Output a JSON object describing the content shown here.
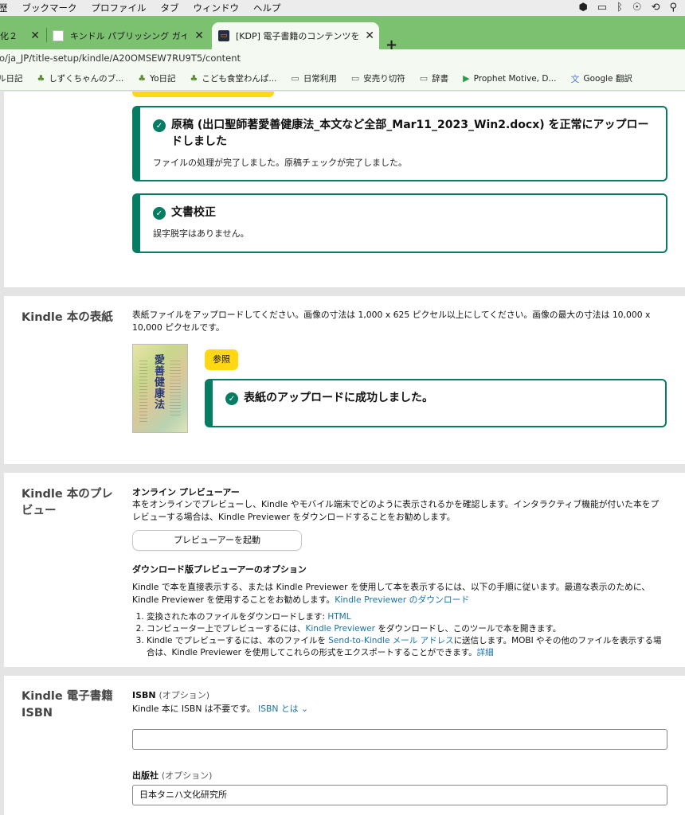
{
  "menubar": {
    "items": [
      "歴",
      "ブックマーク",
      "プロファイル",
      "タブ",
      "ウィンドウ",
      "ヘルプ"
    ]
  },
  "tabs": [
    {
      "label": "化２"
    },
    {
      "label": "キンドル パブリッシング ガイド"
    },
    {
      "label": "[KDP] 電子書籍のコンテンツを編"
    }
  ],
  "url": "o/ja_JP/title-setup/kindle/A20OMSEW7RU9T5/content",
  "bookmarks": [
    {
      "label": "ル日記",
      "icon": "frog-icon"
    },
    {
      "label": "しずくちゃんのブ...",
      "icon": "frog-icon"
    },
    {
      "label": "Yo日記",
      "icon": "frog-icon"
    },
    {
      "label": "こども食堂わんぱ...",
      "icon": "frog-icon"
    },
    {
      "label": "日常利用",
      "icon": "folder-icon"
    },
    {
      "label": "安売り切符",
      "icon": "folder-icon"
    },
    {
      "label": "辞書",
      "icon": "folder-icon"
    },
    {
      "label": "Prophet Motive, D...",
      "icon": "google-play-icon"
    },
    {
      "label": "Google 翻訳",
      "icon": "google-translate-icon"
    }
  ],
  "manuscript": {
    "upload_title": "原稿 (出口聖師著愛善健康法_本文など全部_Mar11_2023_Win2.docx) を正常にアップロードしました",
    "upload_body": "ファイルの処理が完了しました。原稿チェックが完了しました。",
    "proof_title": "文書校正",
    "proof_body": "誤字脱字はありません。"
  },
  "cover": {
    "section_title": "Kindle 本の表紙",
    "description": "表紙ファイルをアップロードしてください。画像の寸法は 1,000 x 625 ピクセル以上にしてください。画像の最大の寸法は 10,000 x 10,000 ピクセルです。",
    "browse_label": "参照",
    "success_title": "表紙のアップロードに成功しました。",
    "thumbnail_title": "愛善健康法"
  },
  "preview": {
    "section_title": "Kindle 本のプレビュー",
    "online_heading": "オンライン プレビューアー",
    "online_desc": "本をオンラインでプレビューし、Kindle やモバイル端末でどのように表示されるかを確認します。インタラクティブ機能が付いた本をプレビューする場合は、Kindle Previewer をダウンロードすることをお勧めします。",
    "launch_label": "プレビューアーを起動",
    "download_heading": "ダウンロード版プレビューアーのオプション",
    "download_desc": "Kindle で本を直接表示する、または Kindle Previewer を使用して本を表示するには、以下の手順に従います。最適な表示のために、Kindle Previewer を使用することをお勧めします。",
    "download_link": "Kindle Previewer のダウンロード",
    "step1_text": "変換された本のファイルをダウンロードします: ",
    "step1_link": "HTML",
    "step2_pre": "コンピューター上でプレビューするには、",
    "step2_link": "Kindle Previewer",
    "step2_post": " をダウンロードし、このツールで本を開きます。",
    "step3_pre": "Kindle でプレビューするには、本のファイルを ",
    "step3_link": "Send-to-Kindle メール アドレス",
    "step3_post": "に送信します。MOBI やその他のファイルを表示する場合は、Kindle Previewer を使用してこれらの形式をエクスポートすることができます。",
    "step3_detail": "詳細"
  },
  "isbn": {
    "section_title": "Kindle 電子書籍 ISBN",
    "isbn_label": "ISBN",
    "optional": "(オプション)",
    "isbn_note": "Kindle 本に ISBN は不要です。",
    "isbn_link": "ISBN とは",
    "isbn_value": "",
    "publisher_label": "出版社",
    "publisher_value": "日本タニハ文化研究所"
  }
}
